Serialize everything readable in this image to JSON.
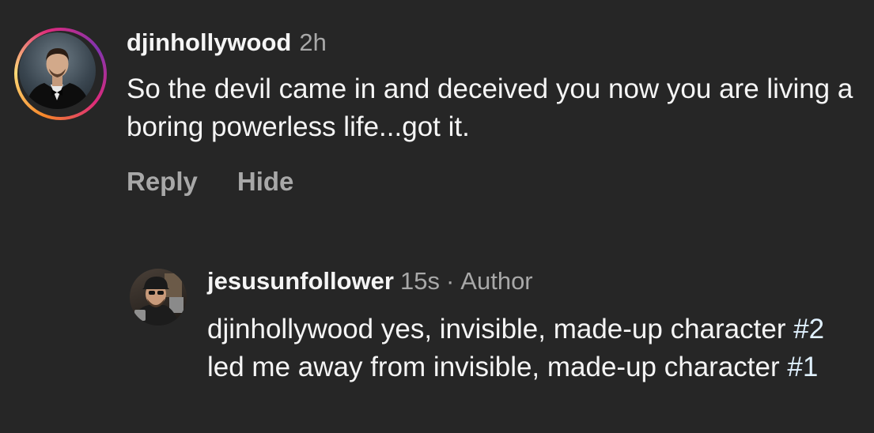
{
  "comment": {
    "username": "djinhollywood",
    "time": "2h",
    "text": "So the devil came in and deceived you now you are living a boring powerless life...got it.",
    "actions": {
      "reply": "Reply",
      "hide": "Hide"
    }
  },
  "reply": {
    "username": "jesusunfollower",
    "time": "15s",
    "separator": "·",
    "badge": "Author",
    "text_part1": "djinhollywood yes, invisible, made-up character ",
    "hashtag1": "#2",
    "text_part2": " led me away from invisible, made-up character ",
    "hashtag2": "#1"
  },
  "colors": {
    "background": "#262626",
    "primary_text": "#f5f5f5",
    "secondary_text": "#a8a8a8",
    "hashtag": "#e0f1ff"
  }
}
